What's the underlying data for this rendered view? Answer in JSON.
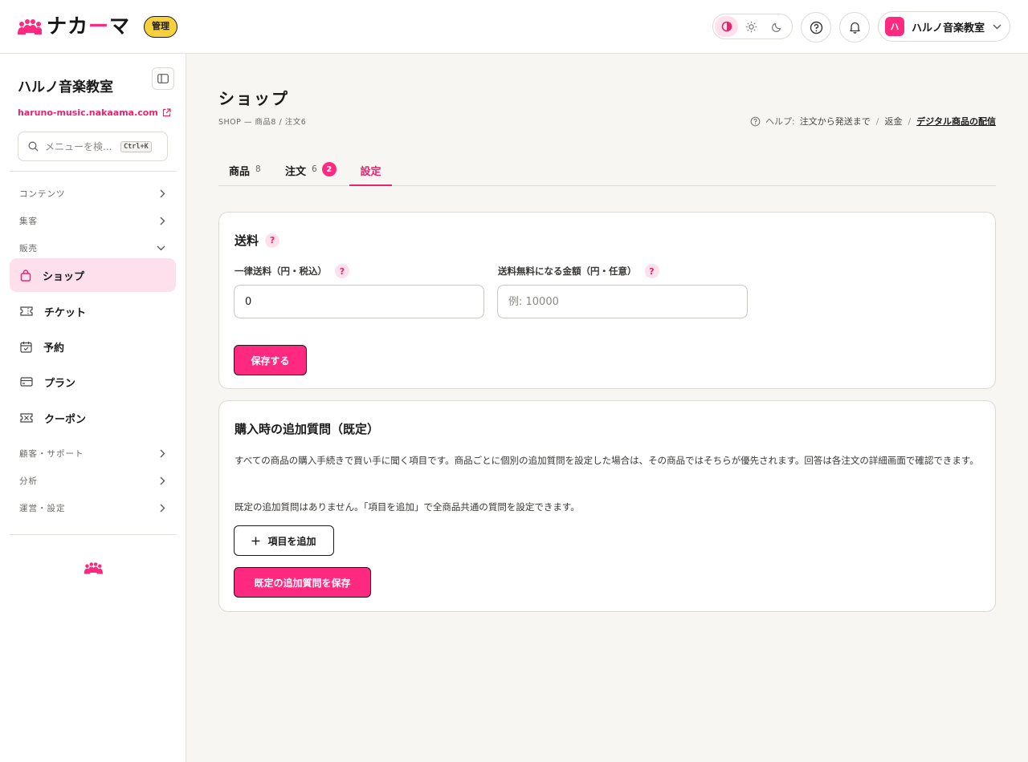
{
  "header": {
    "brand_name_a": "ナカ",
    "brand_name_b": "ー",
    "brand_name_c": "マ",
    "admin_badge": "管理",
    "account_initial": "ハ",
    "account_name": "ハルノ音楽教室"
  },
  "sidebar": {
    "site_name": "ハルノ音楽教室",
    "site_url": "haruno-music.nakaama.com",
    "search_placeholder": "メニューを検...",
    "search_shortcut": "Ctrl+K",
    "sections": {
      "content": "コンテンツ",
      "marketing": "集客",
      "sales": "販売",
      "customers": "顧客・サポート",
      "analytics": "分析",
      "operations": "運営・設定"
    },
    "items": {
      "shop": "ショップ",
      "ticket": "チケット",
      "booking": "予約",
      "plan": "プラン",
      "coupon": "クーポン"
    }
  },
  "page": {
    "title": "ショップ",
    "breadcrumb": "SHOP — 商品8 / 注文6",
    "help_label": "ヘルプ:",
    "help_links": [
      "注文から発送まで",
      "返金",
      "デジタル商品の配信"
    ]
  },
  "tabs": [
    {
      "label": "商品",
      "count": "8"
    },
    {
      "label": "注文",
      "count": "6",
      "badge": "2"
    },
    {
      "label": "設定"
    }
  ],
  "shipping": {
    "title": "送料",
    "flat_label": "一律送料（円・税込）",
    "flat_value": "0",
    "free_label": "送料無料になる金額（円・任意）",
    "free_placeholder": "例: 10000",
    "save_label": "保存する"
  },
  "questions": {
    "title": "購入時の追加質問（既定）",
    "description": "すべての商品の購入手続きで買い手に聞く項目です。商品ごとに個別の追加質問を設定した場合は、その商品ではそちらが優先されます。回答は各注文の詳細画面で確認できます。",
    "empty_note": "既定の追加質問はありません。「項目を追加」で全商品共通の質問を設定できます。",
    "add_label": "項目を追加",
    "save_label": "既定の追加質問を保存"
  },
  "colors": {
    "accent": "#ff2a7f",
    "accent_soft": "#fde0ec",
    "badge_yellow": "#f7d13d"
  }
}
